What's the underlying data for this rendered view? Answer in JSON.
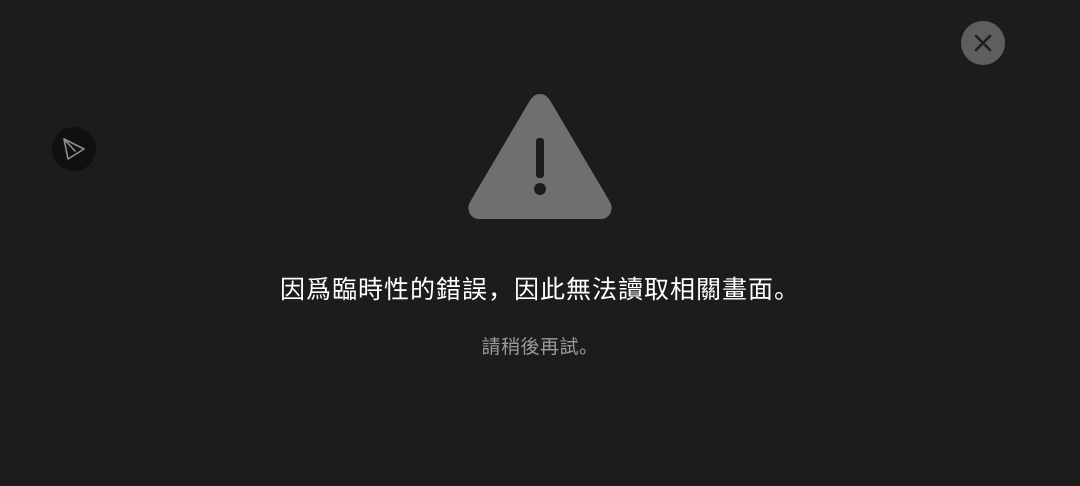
{
  "close_button": {
    "icon": "close-icon"
  },
  "share_button": {
    "icon": "send-icon"
  },
  "warning": {
    "icon": "warning-icon",
    "color": "#6f6f6f"
  },
  "error": {
    "message": "因爲臨時性的錯誤，因此無法讀取相關畫面。",
    "hint": "請稍後再試。"
  }
}
